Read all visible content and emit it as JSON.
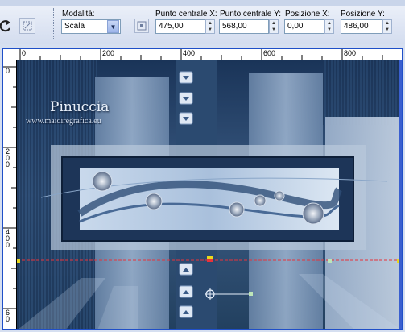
{
  "toolbar": {
    "mode_label": "Modalità:",
    "mode_value": "Scala",
    "center_x_label": "Punto centrale X:",
    "center_x_value": "475,00",
    "center_y_label": "Punto centrale Y:",
    "center_y_value": "568,00",
    "pos_x_label": "Posizione X:",
    "pos_x_value": "0,00",
    "pos_y_label": "Posizione Y:",
    "pos_y_value": "486,00"
  },
  "ruler": {
    "h_labels": [
      "0",
      "200",
      "400",
      "600",
      "800"
    ],
    "v_labels": [
      "0",
      "2\n0\n0",
      "4\n0\n0",
      "6\n0"
    ]
  },
  "artwork": {
    "title": "Pinuccia",
    "subtitle": "www.maidiregrafica.eu"
  },
  "colors": {
    "accent": "#1f4fc8",
    "deform_line": "#e8333a",
    "handle": "#e8d81c"
  }
}
